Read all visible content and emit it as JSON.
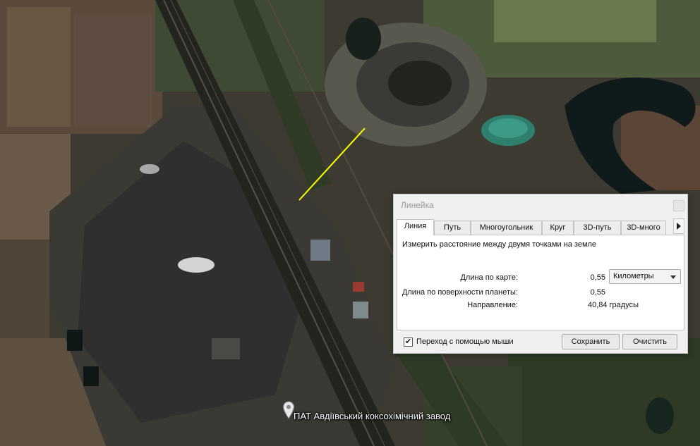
{
  "map": {
    "place_label": "ПАТ Авдіївський коксохімічний завод",
    "measure_line_color": "#ffff00",
    "icons": [
      "location-pin-icon"
    ]
  },
  "ruler": {
    "title": "Линейка",
    "tabs": [
      {
        "label": "Линия",
        "active": true
      },
      {
        "label": "Путь"
      },
      {
        "label": "Многоугольник"
      },
      {
        "label": "Круг"
      },
      {
        "label": "3D-путь"
      },
      {
        "label": "3D-много"
      }
    ],
    "description": "Измерить расстояние между двумя точками на земле",
    "map_length_label": "Длина по карте:",
    "map_length_value": "0,55",
    "unit_selected": "Километры",
    "surface_length_label": "Длина по поверхности планеты:",
    "surface_length_value": "0,55",
    "heading_label": "Направление:",
    "heading_value": "40,84 градусы",
    "mouse_nav_label": "Переход с помощью мыши",
    "mouse_nav_checked": true,
    "save_label": "Сохранить",
    "clear_label": "Очистить"
  }
}
